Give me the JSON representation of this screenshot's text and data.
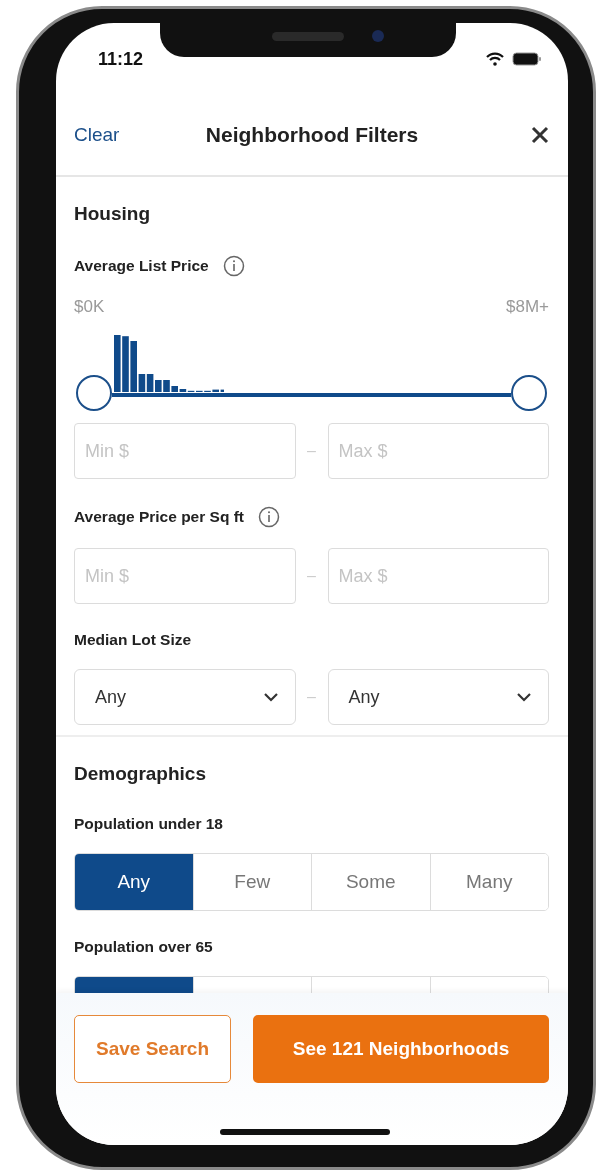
{
  "status_bar": {
    "time": "11:12"
  },
  "header": {
    "clear": "Clear",
    "title": "Neighborhood Filters"
  },
  "sections": [
    {
      "title": "Housing",
      "filters": [
        {
          "kind": "range_slider",
          "label": "Average List Price",
          "info": true,
          "min_label": "$0K",
          "max_label": "$8M+",
          "thumbs": [
            {
              "level": 0
            },
            {
              "level": 1
            }
          ],
          "inputs": [
            {
              "placeholder": "Min $"
            },
            {
              "placeholder": "Max $"
            }
          ],
          "separator": "–"
        },
        {
          "kind": "inputs",
          "label": "Average Price per Sq ft",
          "info": true,
          "inputs": [
            {
              "placeholder": "Min $"
            },
            {
              "placeholder": "Max $"
            }
          ],
          "separator": "–"
        },
        {
          "kind": "selects",
          "label": "Median Lot Size",
          "info": false,
          "selects": [
            {
              "value": "Any"
            },
            {
              "value": "Any"
            }
          ],
          "separator": "–"
        }
      ]
    },
    {
      "title": "Demographics",
      "filters": [
        {
          "kind": "segments",
          "label": "Population under 18",
          "info": false,
          "options": [
            {
              "label": "Any",
              "selected": true
            },
            {
              "label": "Few",
              "selected": false
            },
            {
              "label": "Some",
              "selected": false
            },
            {
              "label": "Many",
              "selected": false
            }
          ]
        },
        {
          "kind": "segments",
          "label": "Population over 65",
          "info": false,
          "options": [
            {
              "selected": true
            },
            {
              "selected": false
            },
            {
              "selected": false
            },
            {
              "selected": false
            }
          ]
        }
      ]
    }
  ],
  "footer": {
    "save": "Save Search",
    "see": "See 121 Neighborhoods"
  }
}
